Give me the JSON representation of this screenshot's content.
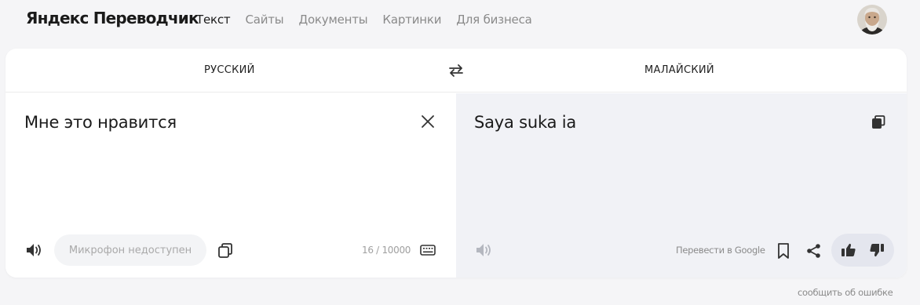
{
  "header": {
    "logo": "Яндекс Переводчик",
    "nav": [
      {
        "label": "Текст",
        "active": true
      },
      {
        "label": "Сайты",
        "active": false
      },
      {
        "label": "Документы",
        "active": false
      },
      {
        "label": "Картинки",
        "active": false
      },
      {
        "label": "Для бизнеса",
        "active": false
      }
    ]
  },
  "languages": {
    "source": "РУССКИЙ",
    "target": "МАЛАЙСКИЙ"
  },
  "source": {
    "text": "Мне это нравится",
    "mic_label": "Микрофон недоступен",
    "counter": "16 / 10000"
  },
  "target": {
    "text": "Saya suka ia",
    "google_link": "Перевести в Google"
  },
  "footer": {
    "report_link": "сообщить об ошибке"
  },
  "colors": {
    "page_bg": "#f5f5f7",
    "target_pane_bg": "#f1f2f6",
    "muted_text": "#8a8a8a"
  }
}
